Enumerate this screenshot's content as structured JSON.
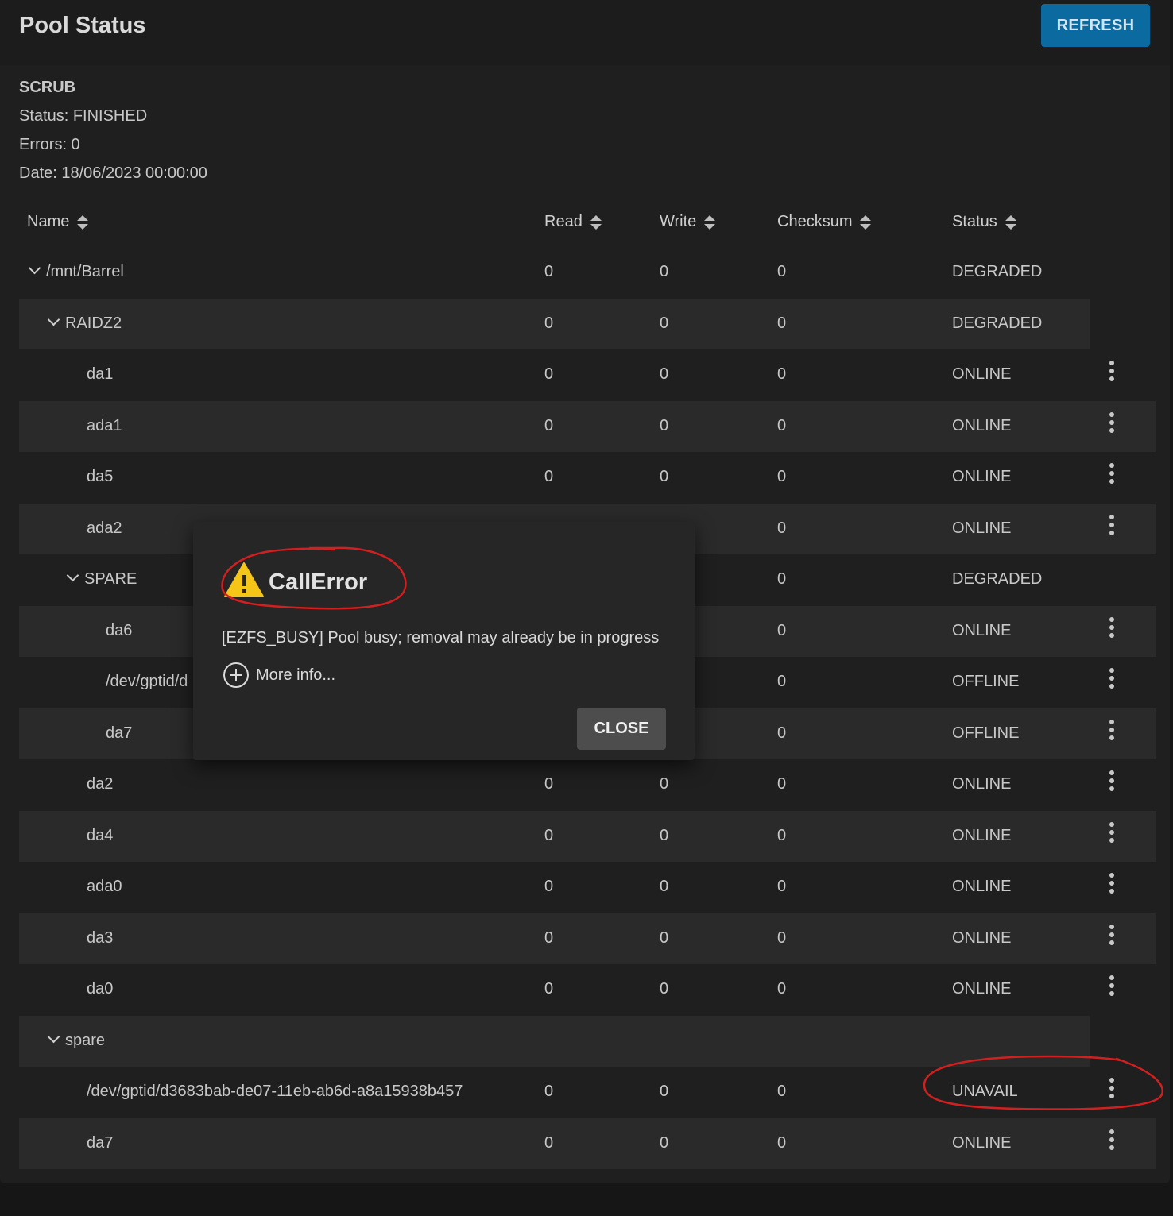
{
  "header": {
    "title": "Pool Status",
    "refresh_label": "REFRESH"
  },
  "scrub": {
    "title": "SCRUB",
    "status": "Status: FINISHED",
    "errors": "Errors: 0",
    "date": "Date: 18/06/2023 00:00:00"
  },
  "columns": {
    "name": "Name",
    "read": "Read",
    "write": "Write",
    "checksum": "Checksum",
    "status": "Status"
  },
  "rows": [
    {
      "name": "/mnt/Barrel",
      "read": "0",
      "write": "0",
      "checksum": "0",
      "status": "DEGRADED"
    },
    {
      "name": "RAIDZ2",
      "read": "0",
      "write": "0",
      "checksum": "0",
      "status": "DEGRADED"
    },
    {
      "name": "da1",
      "read": "0",
      "write": "0",
      "checksum": "0",
      "status": "ONLINE"
    },
    {
      "name": "ada1",
      "read": "0",
      "write": "0",
      "checksum": "0",
      "status": "ONLINE"
    },
    {
      "name": "da5",
      "read": "0",
      "write": "0",
      "checksum": "0",
      "status": "ONLINE"
    },
    {
      "name": "ada2",
      "read": "",
      "write": "",
      "checksum": "0",
      "status": "ONLINE"
    },
    {
      "name": "SPARE",
      "read": "",
      "write": "",
      "checksum": "0",
      "status": "DEGRADED"
    },
    {
      "name": "da6",
      "read": "",
      "write": "",
      "checksum": "0",
      "status": "ONLINE"
    },
    {
      "name": "/dev/gptid/d",
      "read": "",
      "write": "",
      "checksum": "0",
      "status": "OFFLINE"
    },
    {
      "name": "da7",
      "read": "",
      "write": "",
      "checksum": "0",
      "status": "OFFLINE"
    },
    {
      "name": "da2",
      "read": "0",
      "write": "0",
      "checksum": "0",
      "status": "ONLINE"
    },
    {
      "name": "da4",
      "read": "0",
      "write": "0",
      "checksum": "0",
      "status": "ONLINE"
    },
    {
      "name": "ada0",
      "read": "0",
      "write": "0",
      "checksum": "0",
      "status": "ONLINE"
    },
    {
      "name": "da3",
      "read": "0",
      "write": "0",
      "checksum": "0",
      "status": "ONLINE"
    },
    {
      "name": "da0",
      "read": "0",
      "write": "0",
      "checksum": "0",
      "status": "ONLINE"
    },
    {
      "name": "spare",
      "read": "",
      "write": "",
      "checksum": "",
      "status": ""
    },
    {
      "name": "/dev/gptid/d3683bab-de07-11eb-ab6d-a8a15938b457",
      "read": "0",
      "write": "0",
      "checksum": "0",
      "status": "UNAVAIL"
    },
    {
      "name": "da7",
      "read": "0",
      "write": "0",
      "checksum": "0",
      "status": "ONLINE"
    }
  ],
  "dialog": {
    "title": "CallError",
    "message": "[EZFS_BUSY] Pool busy; removal may already be in progress",
    "more_info": "More info...",
    "close_label": "CLOSE"
  },
  "icons": {
    "warning": "warning-icon",
    "more_info": "plus-circle-icon",
    "row_menu": "more-vert-icon",
    "expand": "chevron-down-icon",
    "sort": "sort-icon"
  },
  "colors": {
    "accent": "#0b6aa0",
    "warning": "#f5c518",
    "annotation": "#d21f1f"
  }
}
